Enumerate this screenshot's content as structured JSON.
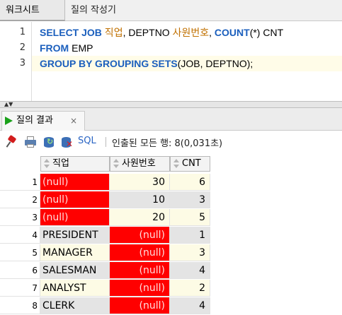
{
  "tabs": {
    "worksheet": "워크시트",
    "query_builder": "질의 작성기"
  },
  "editor": {
    "lines": [
      {
        "num": "1",
        "parts": [
          {
            "t": "SELECT ",
            "c": "kw"
          },
          {
            "t": "JOB",
            "c": "kw"
          },
          {
            "t": " 직업",
            "c": "alias"
          },
          {
            "t": ", DEPTNO ",
            "c": "txt"
          },
          {
            "t": "사원번호",
            "c": "alias"
          },
          {
            "t": ", ",
            "c": "txt"
          },
          {
            "t": "COUNT",
            "c": "kw"
          },
          {
            "t": "(*) CNT",
            "c": "txt"
          }
        ]
      },
      {
        "num": "2",
        "parts": [
          {
            "t": "FROM ",
            "c": "kw"
          },
          {
            "t": "EMP",
            "c": "txt"
          }
        ]
      },
      {
        "num": "3",
        "parts": [
          {
            "t": "GROUP BY GROUPING SETS",
            "c": "kw"
          },
          {
            "t": "(JOB, DEPTNO);",
            "c": "txt"
          }
        ]
      }
    ]
  },
  "results": {
    "tab_label": "질의 결과",
    "close": "×",
    "toolbar": {
      "sql": "SQL",
      "fetch_status": "인출된 모든 행: 8(0,031초)"
    },
    "columns": [
      "직업",
      "사원번호",
      "CNT"
    ],
    "rows": [
      {
        "n": "1",
        "job": "(null)",
        "deptno": "30",
        "cnt": "6"
      },
      {
        "n": "2",
        "job": "(null)",
        "deptno": "10",
        "cnt": "3"
      },
      {
        "n": "3",
        "job": "(null)",
        "deptno": "20",
        "cnt": "5"
      },
      {
        "n": "4",
        "job": "PRESIDENT",
        "deptno": "(null)",
        "cnt": "1"
      },
      {
        "n": "5",
        "job": "MANAGER",
        "deptno": "(null)",
        "cnt": "3"
      },
      {
        "n": "6",
        "job": "SALESMAN",
        "deptno": "(null)",
        "cnt": "4"
      },
      {
        "n": "7",
        "job": "ANALYST",
        "deptno": "(null)",
        "cnt": "2"
      },
      {
        "n": "8",
        "job": "CLERK",
        "deptno": "(null)",
        "cnt": "4"
      }
    ],
    "null_highlight_color": "#ff0000"
  }
}
